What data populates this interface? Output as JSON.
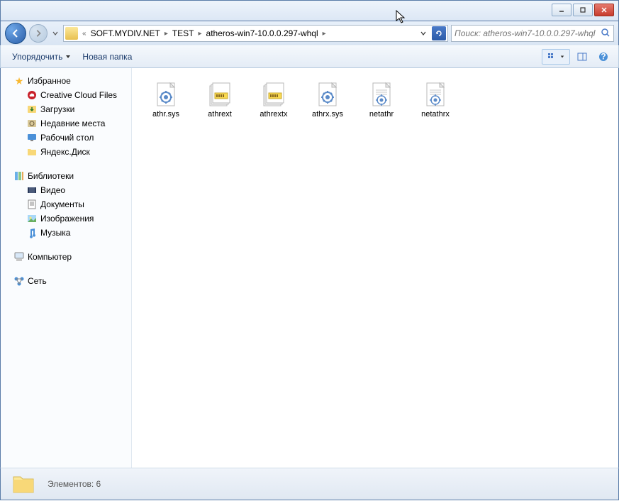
{
  "breadcrumb": {
    "parts": [
      "SOFT.MYDIV.NET",
      "TEST",
      "atheros-win7-10.0.0.297-whql"
    ],
    "prefix": "«"
  },
  "search": {
    "placeholder": "Поиск: atheros-win7-10.0.0.297-whql"
  },
  "toolbar": {
    "organize": "Упорядочить",
    "newfolder": "Новая папка"
  },
  "sidebar": {
    "favorites": {
      "label": "Избранное",
      "items": [
        "Creative Cloud Files",
        "Загрузки",
        "Недавние места",
        "Рабочий стол",
        "Яндекс.Диск"
      ]
    },
    "libraries": {
      "label": "Библиотеки",
      "items": [
        "Видео",
        "Документы",
        "Изображения",
        "Музыка"
      ]
    },
    "computer": {
      "label": "Компьютер"
    },
    "network": {
      "label": "Сеть"
    }
  },
  "files": [
    {
      "name": "athr.sys",
      "type": "sys"
    },
    {
      "name": "athrext",
      "type": "cat"
    },
    {
      "name": "athrextx",
      "type": "cat"
    },
    {
      "name": "athrx.sys",
      "type": "sys"
    },
    {
      "name": "netathr",
      "type": "inf"
    },
    {
      "name": "netathrx",
      "type": "inf"
    }
  ],
  "status": {
    "text": "Элементов: 6"
  }
}
